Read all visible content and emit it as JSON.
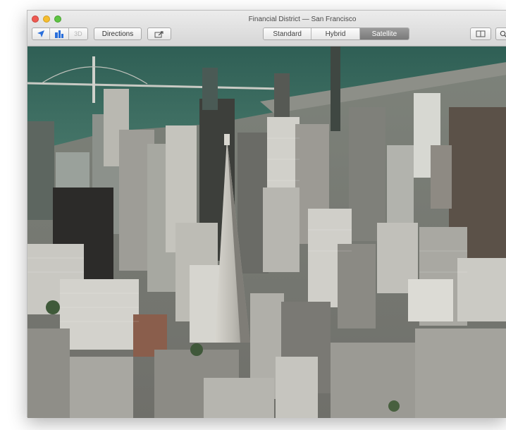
{
  "window": {
    "title": "Financial District — San Francisco"
  },
  "toolbar": {
    "location_icon": "location-arrow-icon",
    "view_3d_icon": "buildings-3d-icon",
    "view_3d_label": "3D",
    "directions_label": "Directions",
    "share_icon": "share-icon",
    "map_modes": [
      {
        "label": "Standard",
        "active": false
      },
      {
        "label": "Hybrid",
        "active": false
      },
      {
        "label": "Satellite",
        "active": true
      }
    ],
    "sidebar_icon": "book-sidebar-icon",
    "search_icon": "search-icon"
  },
  "map": {
    "mode": "satellite-3d-flyover",
    "accent_water": "#3f6f63",
    "accent_toolbar_blue": "#2a6fdb"
  }
}
